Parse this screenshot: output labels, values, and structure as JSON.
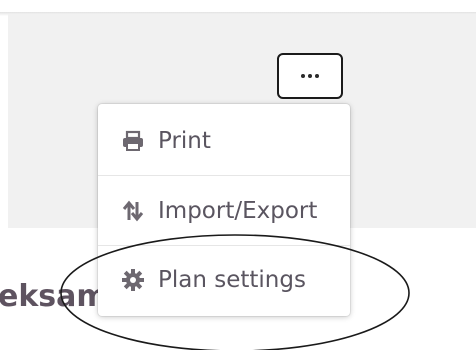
{
  "page": {
    "card_title_fragment": "eksam"
  },
  "more_button": {
    "icon": "more-horizontal-icon"
  },
  "menu": {
    "items": [
      {
        "label": "Print",
        "icon": "printer-icon"
      },
      {
        "label": "Import/Export",
        "icon": "import-export-icon"
      },
      {
        "label": "Plan settings",
        "icon": "gear-icon"
      }
    ]
  },
  "colors": {
    "menu_text": "#5a5560",
    "icon": "#6d6870",
    "panel_bg": "#f1f1f1",
    "title_text": "#5e5360"
  }
}
